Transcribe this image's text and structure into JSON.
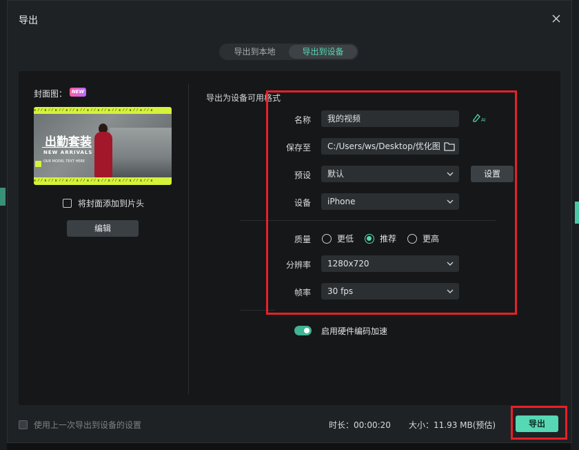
{
  "dialog": {
    "title": "导出"
  },
  "tabs": [
    {
      "label": "导出到本地",
      "active": false
    },
    {
      "label": "导出到设备",
      "active": true
    }
  ],
  "left": {
    "cover_label": "封面图：",
    "new_badge": "NEW",
    "thumbnail": {
      "title": "出勤套装",
      "subtitle": "NEW ARRIVALS",
      "small_text": "OUR MODEL TEXT HERE"
    },
    "add_cover_checkbox": {
      "label": "将封面添加到片头",
      "checked": false
    },
    "edit_button": "编辑"
  },
  "right": {
    "section_label": "导出为设备可用格式",
    "name": {
      "label": "名称",
      "value": "我的视频"
    },
    "save_to": {
      "label": "保存至",
      "value": "C:/Users/ws/Desktop/优化图"
    },
    "preset": {
      "label": "预设",
      "value": "默认",
      "button": "设置"
    },
    "device": {
      "label": "设备",
      "value": "iPhone"
    },
    "quality": {
      "label": "质量",
      "options": [
        {
          "label": "更低",
          "selected": false
        },
        {
          "label": "推荐",
          "selected": true
        },
        {
          "label": "更高",
          "selected": false
        }
      ]
    },
    "resolution": {
      "label": "分辨率",
      "value": "1280x720"
    },
    "framerate": {
      "label": "帧率",
      "value": "30 fps"
    },
    "hw_accel": {
      "label": "启用硬件编码加速",
      "enabled": true
    }
  },
  "footer": {
    "remember_checkbox": {
      "label": "使用上一次导出到设备的设置",
      "checked": false
    },
    "duration": "时长：00:00:20",
    "size": "大小：11.93 MB(预估)",
    "export_button": "导出"
  },
  "colors": {
    "accent": "#55d8b3",
    "highlight": "#e8202a",
    "dialog_bg": "#1f2224"
  }
}
